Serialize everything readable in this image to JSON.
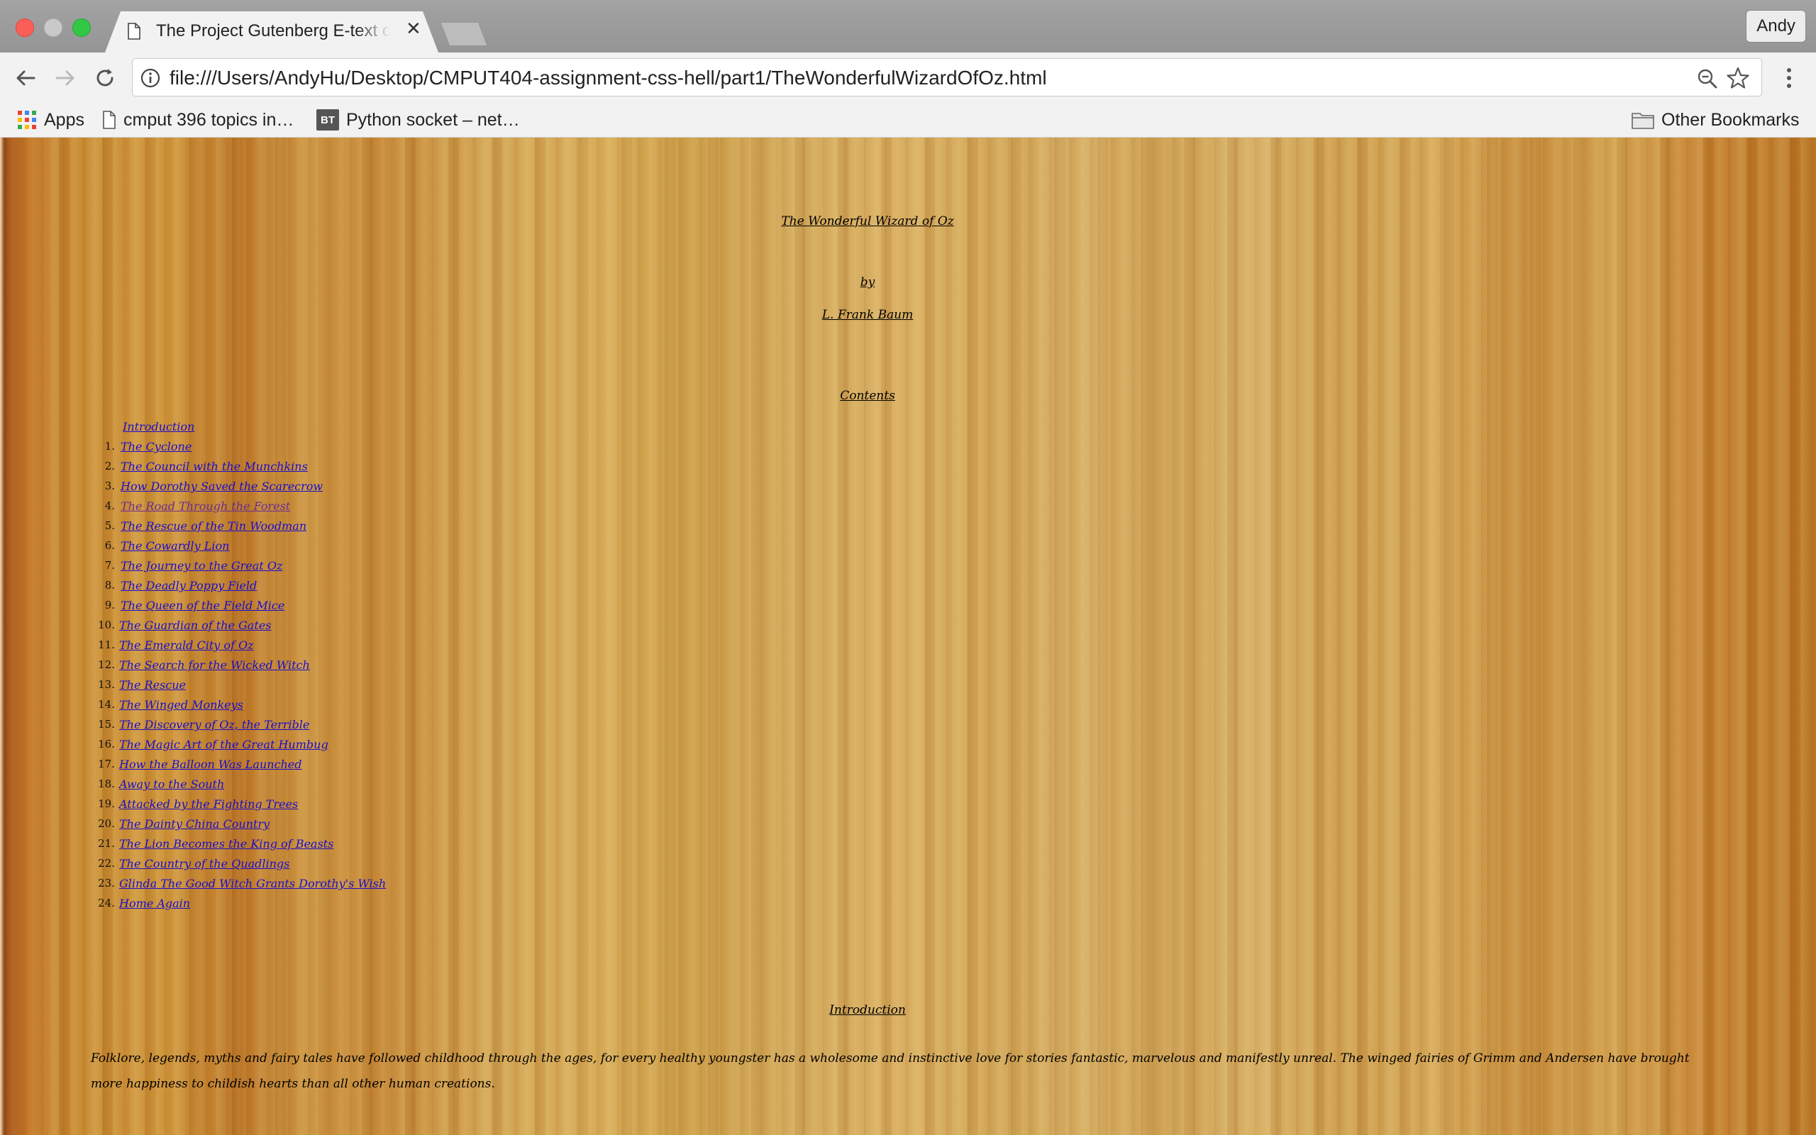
{
  "browser": {
    "tab_title": "The Project Gutenberg E-text of The Wonderful Wizard of Oz",
    "profile_name": "Andy",
    "url": "file:///Users/AndyHu/Desktop/CMPUT404-assignment-css-hell/part1/TheWonderfulWizardOfOz.html",
    "bookmarks": {
      "apps_label": "Apps",
      "item1_label": "cmput 396 topics in…",
      "item2_badge": "BT",
      "item2_label": "Python socket – net…",
      "other_label": "Other Bookmarks"
    }
  },
  "page": {
    "title": "The Wonderful Wizard of Oz",
    "by": "by",
    "author": "L. Frank Baum",
    "contents_heading": "Contents",
    "intro_link": "Introduction",
    "chapters": [
      "The Cyclone",
      "The Council with the Munchkins",
      "How Dorothy Saved the Scarecrow",
      "The Road Through the Forest",
      "The Rescue of the Tin Woodman",
      "The Cowardly Lion",
      "The Journey to the Great Oz",
      "The Deadly Poppy Field",
      "The Queen of the Field Mice",
      "The Guardian of the Gates",
      "The Emerald City of Oz",
      "The Search for the Wicked Witch",
      "The Rescue",
      "The Winged Monkeys",
      "The Discovery of Oz, the Terrible",
      "The Magic Art of the Great Humbug",
      "How the Balloon Was Launched",
      "Away to the South",
      "Attacked by the Fighting Trees",
      "The Dainty China Country",
      "The Lion Becomes the King of Beasts",
      "The Country of the Quadlings",
      "Glinda The Good Witch Grants Dorothy's Wish",
      "Home Again"
    ],
    "visited_chapter": 4,
    "intro_heading": "Introduction",
    "intro_paragraph": "Folklore, legends, myths and fairy tales have followed childhood through the ages, for every healthy youngster has a wholesome and instinctive love for stories fantastic, marvelous and manifestly unreal. The winged fairies of Grimm and Andersen have brought more happiness to childish hearts than all other human creations."
  },
  "colors": {
    "link": "#1a0dcc",
    "visited_link": "#6a2d8f",
    "background_wood": "#cfa04e"
  }
}
